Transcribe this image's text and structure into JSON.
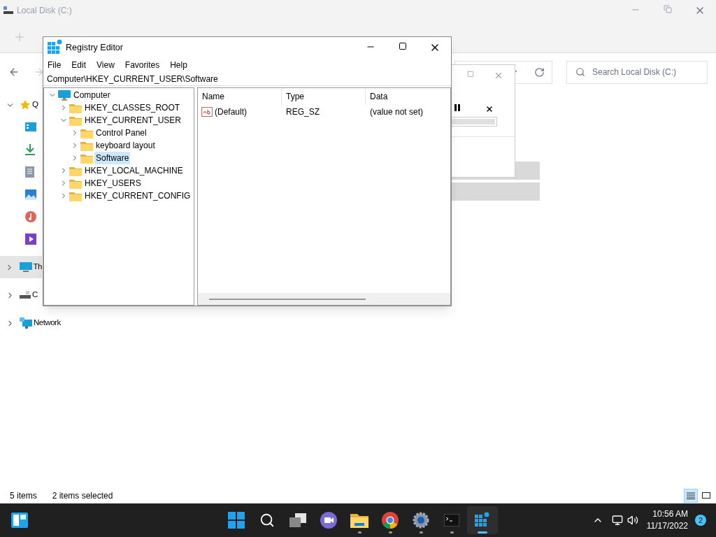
{
  "explorer": {
    "title": "Local Disk (C:)",
    "search": {
      "placeholder": "Search Local Disk (C:)"
    },
    "nav_items": [
      {
        "label": "Q",
        "expanded": true,
        "selected": false,
        "kind": "star"
      },
      {
        "kind": "desktop"
      },
      {
        "kind": "downloads"
      },
      {
        "kind": "documents"
      },
      {
        "kind": "pictures"
      },
      {
        "kind": "music"
      },
      {
        "kind": "videos"
      },
      {
        "label": "Th",
        "expanded": false,
        "selected": true,
        "kind": "pc"
      },
      {
        "label": "C",
        "expanded": false,
        "selected": false,
        "kind": "drive"
      },
      {
        "label": "Network",
        "expanded": false,
        "selected": false,
        "kind": "network"
      }
    ],
    "file_rows": [
      {
        "selected": true
      },
      {
        "selected": true
      }
    ],
    "status_bar": {
      "count": "5 items",
      "selection": "2 items selected"
    },
    "view_buttons": [
      {
        "kind": "details",
        "selected": true
      },
      {
        "kind": "tiles",
        "selected": false
      }
    ]
  },
  "copy_dialog": {
    "progress": {
      "level": 1
    }
  },
  "registry_editor": {
    "title": "Registry Editor",
    "menu": [
      "File",
      "Edit",
      "View",
      "Favorites",
      "Help"
    ],
    "address": "Computer\\HKEY_CURRENT_USER\\Software",
    "tree": {
      "label": "Computer",
      "kind": "computer",
      "expanded": true,
      "selected": false,
      "children": [
        {
          "label": "HKEY_CLASSES_ROOT",
          "expanded": false,
          "selected": false
        },
        {
          "label": "HKEY_CURRENT_USER",
          "expanded": true,
          "selected": false,
          "children": [
            {
              "label": "Control Panel",
              "expanded": false,
              "selected": false
            },
            {
              "label": "keyboard layout",
              "expanded": false,
              "selected": false
            },
            {
              "label": "Software",
              "expanded": false,
              "selected": true
            }
          ]
        },
        {
          "label": "HKEY_LOCAL_MACHINE",
          "expanded": false,
          "selected": false
        },
        {
          "label": "HKEY_USERS",
          "expanded": false,
          "selected": false
        },
        {
          "label": "HKEY_CURRENT_CONFIG",
          "expanded": false,
          "selected": false
        }
      ]
    },
    "columns": [
      "Name",
      "Type",
      "Data"
    ],
    "rows": [
      {
        "name": "(Default)",
        "type": "REG_SZ",
        "data": "(value not set)"
      }
    ]
  },
  "taskbar": {
    "apps": [
      {
        "kind": "start",
        "running": false,
        "active": false
      },
      {
        "kind": "search",
        "running": false,
        "active": false
      },
      {
        "kind": "taskview",
        "running": false,
        "active": false
      },
      {
        "kind": "chat",
        "running": false,
        "active": false
      },
      {
        "kind": "files",
        "running": true,
        "active": false
      },
      {
        "kind": "chrome",
        "running": true,
        "active": false
      },
      {
        "kind": "settings",
        "running": true,
        "active": false
      },
      {
        "kind": "terminal",
        "running": true,
        "active": false
      },
      {
        "kind": "regedit",
        "running": true,
        "active": true
      }
    ],
    "time": "10:56 AM",
    "date": "11/17/2022",
    "notifications": "2"
  }
}
